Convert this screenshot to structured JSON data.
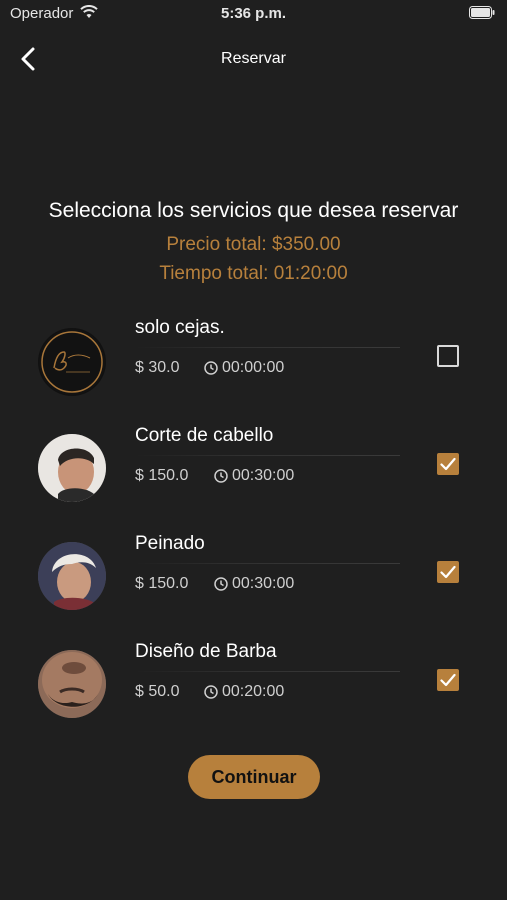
{
  "status_bar": {
    "carrier": "Operador",
    "time": "5:36 p.m."
  },
  "nav": {
    "title": "Reservar",
    "back_icon": "chevron-left-icon"
  },
  "heading": "Selecciona los servicios que desea reservar",
  "totals": {
    "price": "Precio total: $350.00",
    "time": "Tiempo total: 01:20:00"
  },
  "services": [
    {
      "name": "solo cejas.",
      "price": "$ 30.0",
      "duration": "00:00:00",
      "selected": false,
      "avatar": "logo"
    },
    {
      "name": "Corte de cabello",
      "price": "$ 150.0",
      "duration": "00:30:00",
      "selected": true,
      "avatar": "haircut-photo"
    },
    {
      "name": "Peinado",
      "price": "$ 150.0",
      "duration": "00:30:00",
      "selected": true,
      "avatar": "styled-hair-photo"
    },
    {
      "name": "Diseño de Barba",
      "price": "$ 50.0",
      "duration": "00:20:00",
      "selected": true,
      "avatar": "beard-photo"
    }
  ],
  "continue_label": "Continuar",
  "colors": {
    "background": "#1f1f1f",
    "accent": "#b7803c",
    "text": "#ffffff",
    "muted": "#cfcfcf"
  }
}
